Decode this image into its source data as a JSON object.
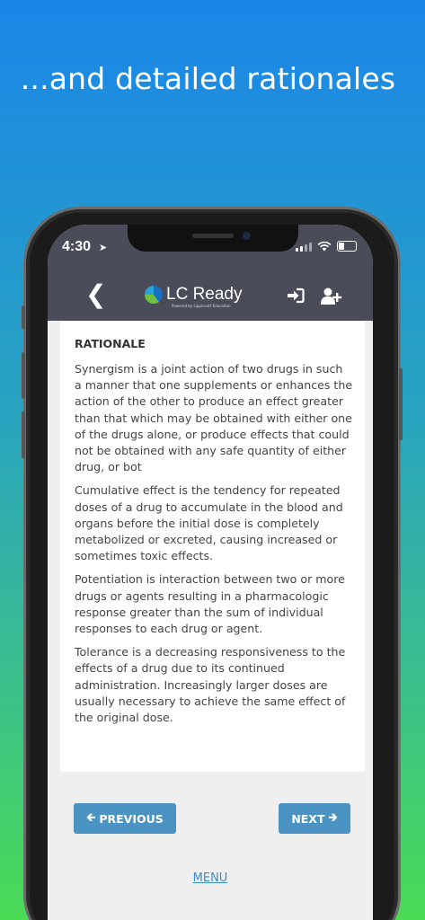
{
  "headline": "...and detailed rationales",
  "status_bar": {
    "time": "4:30",
    "location_icon": "location-arrow-icon",
    "signal_icon": "cellular-signal-icon",
    "wifi_icon": "wifi-icon",
    "battery_icon": "battery-icon"
  },
  "navbar": {
    "back_icon": "chevron-left-icon",
    "logo_text": "LC Ready",
    "logo_subtext": "Powered by Lippincott Education",
    "login_icon": "sign-in-icon",
    "add_user_icon": "user-plus-icon",
    "background": "#4a4d59"
  },
  "rationale": {
    "title": "RATIONALE",
    "paragraphs": [
      "Synergism is a joint action of two drugs in such a manner that one supplements or enhances the action of the other to produce an effect greater than that which may be obtained with either one of the drugs alone, or produce effects that could not be obtained with any safe quantity of either drug, or bot",
      "Cumulative effect is the tendency for repeated doses of a drug to accumulate in the blood and organs before the initial dose is completely metabolized or excreted, causing increased or sometimes toxic effects.",
      "Potentiation is interaction between two or more drugs or agents resulting in a pharmacologic response greater than the sum of individual responses to each drug or agent.",
      "Tolerance is a decreasing responsiveness to the effects of a drug due to its continued administration. Increasingly larger doses are usually necessary to achieve the same effect of the original dose."
    ]
  },
  "buttons": {
    "previous_label": "PREVIOUS",
    "previous_icon": "arrow-left-icon",
    "next_label": "NEXT",
    "next_icon": "arrow-right-icon",
    "color": "#4a93c2"
  },
  "menu_label": "MENU"
}
